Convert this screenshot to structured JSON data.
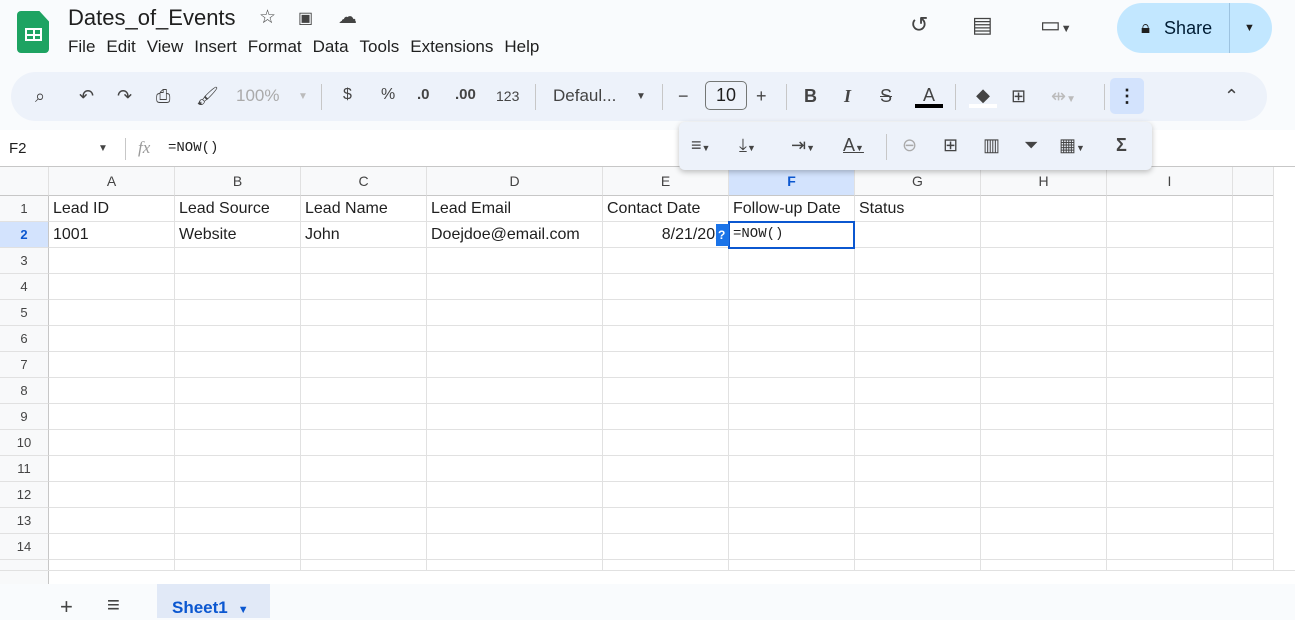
{
  "app": {
    "title": "Dates_of_Events",
    "menu": [
      "File",
      "Edit",
      "View",
      "Insert",
      "Format",
      "Data",
      "Tools",
      "Extensions",
      "Help"
    ],
    "share_label": "Share",
    "brand_color": "#1ea362",
    "accent": "#0b57d0"
  },
  "toolbar": {
    "zoom": "100%",
    "currency": "$",
    "percent": "%",
    "dec_decrease": ".0",
    "dec_increase": ".00",
    "number_format": "123",
    "font": "Defaul...",
    "font_size": "10",
    "bold": "B",
    "italic": "I",
    "text_color": "A",
    "sum": "Σ"
  },
  "formula_bar": {
    "name_box": "F2",
    "fx": "fx",
    "formula": "=NOW()"
  },
  "grid": {
    "columns": [
      "A",
      "B",
      "C",
      "D",
      "E",
      "F",
      "G",
      "H",
      "I"
    ],
    "rows": [
      "1",
      "2",
      "3",
      "4",
      "5",
      "6",
      "7",
      "8",
      "9",
      "10",
      "11",
      "12",
      "13",
      "14"
    ],
    "cells": [
      [
        "Lead ID",
        "Lead Source",
        "Lead Name",
        "Lead Email",
        "Contact Date",
        "Follow-up Date",
        "Status",
        "",
        ""
      ],
      [
        "1001",
        "Website",
        "John",
        "Doejdoe@email.com",
        "8/21/202",
        "=NOW()",
        "",
        "",
        ""
      ]
    ],
    "selected": "F2",
    "help_badge": "?"
  },
  "sheets": {
    "tabs": [
      "Sheet1"
    ],
    "add": "+",
    "list": "≡"
  }
}
